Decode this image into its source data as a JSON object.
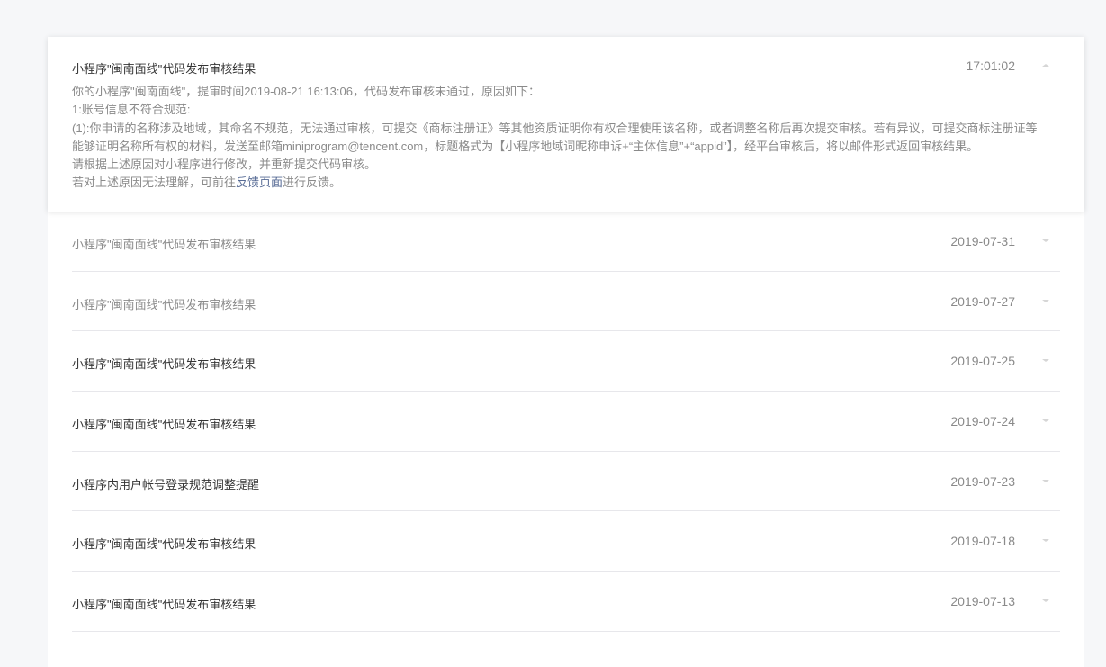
{
  "expanded": {
    "title": "小程序\"闽南面线\"代码发布审核结果",
    "time": "17:01:02",
    "lines": [
      "你的小程序\"闽南面线\"，提审时间2019-08-21 16:13:06，代码发布审核未通过，原因如下：",
      "1:账号信息不符合规范:",
      "(1):你申请的名称涉及地域，其命名不规范，无法通过审核，可提交《商标注册证》等其他资质证明你有权合理使用该名称，或者调整名称后再次提交审核。若有异议，可提交商标注册证等",
      "能够证明名称所有权的材料，发送至邮箱miniprogram@tencent.com，标题格式为【小程序地域词昵称申诉+“主体信息”+“appid”】，经平台审核后，将以邮件形式返回审核结果。",
      "请根据上述原因对小程序进行修改，并重新提交代码审核。"
    ],
    "last_prefix": "若对上述原因无法理解，可前往",
    "link_text": "反馈页面",
    "last_suffix": "进行反馈。"
  },
  "messages": [
    {
      "title": "小程序\"闽南面线\"代码发布审核结果",
      "date": "2019-07-31"
    },
    {
      "title": "小程序\"闽南面线\"代码发布审核结果",
      "date": "2019-07-27"
    },
    {
      "title": "小程序\"闽南面线\"代码发布审核结果",
      "date": "2019-07-25"
    },
    {
      "title": "小程序\"闽南面线\"代码发布审核结果",
      "date": "2019-07-24"
    },
    {
      "title": "小程序内用户帐号登录规范调整提醒",
      "date": "2019-07-23"
    },
    {
      "title": "小程序\"闽南面线\"代码发布审核结果",
      "date": "2019-07-18"
    },
    {
      "title": "小程序\"闽南面线\"代码发布审核结果",
      "date": "2019-07-13"
    }
  ]
}
